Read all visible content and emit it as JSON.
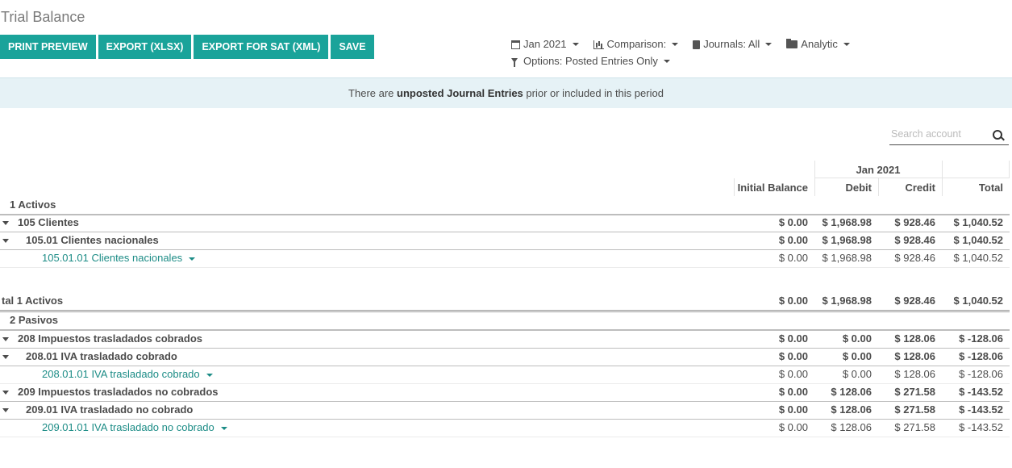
{
  "page": {
    "title": "Trial Balance"
  },
  "buttons": [
    "PRINT PREVIEW",
    "EXPORT (XLSX)",
    "EXPORT FOR SAT (XML)",
    "SAVE"
  ],
  "filters": {
    "date": "Jan 2021",
    "comparison": "Comparison:",
    "journals": "Journals: All",
    "analytic": "Analytic",
    "options": "Options: Posted Entries Only"
  },
  "alert": {
    "pre": "There are ",
    "bold": "unposted Journal Entries",
    "post": " prior or included in this period"
  },
  "search": {
    "placeholder": "Search account"
  },
  "table": {
    "period": "Jan 2021",
    "columns": [
      "Initial Balance",
      "Debit",
      "Credit",
      "Total"
    ],
    "rows": [
      {
        "label": "1 Activos",
        "values": [
          "",
          "",
          "",
          ""
        ],
        "style": "group"
      },
      {
        "label": "105 Clientes",
        "values": [
          "$ 0.00",
          "$ 1,968.98",
          "$ 928.46",
          "$ 1,040.52"
        ],
        "style": "lvl1"
      },
      {
        "label": "105.01 Clientes nacionales",
        "values": [
          "$ 0.00",
          "$ 1,968.98",
          "$ 928.46",
          "$ 1,040.52"
        ],
        "style": "lvl2"
      },
      {
        "label": "105.01.01 Clientes nacionales",
        "values": [
          "$ 0.00",
          "$ 1,968.98",
          "$ 928.46",
          "$ 1,040.52"
        ],
        "style": "account"
      },
      {
        "label": "tal 1 Activos",
        "values": [
          "$ 0.00",
          "$ 1,968.98",
          "$ 928.46",
          "$ 1,040.52"
        ],
        "style": "total"
      },
      {
        "label": "2 Pasivos",
        "values": [
          "",
          "",
          "",
          ""
        ],
        "style": "group"
      },
      {
        "label": "208 Impuestos trasladados cobrados",
        "values": [
          "$ 0.00",
          "$ 0.00",
          "$ 128.06",
          "$ -128.06"
        ],
        "style": "lvl1"
      },
      {
        "label": "208.01 IVA trasladado cobrado",
        "values": [
          "$ 0.00",
          "$ 0.00",
          "$ 128.06",
          "$ -128.06"
        ],
        "style": "lvl2"
      },
      {
        "label": "208.01.01 IVA trasladado cobrado",
        "values": [
          "$ 0.00",
          "$ 0.00",
          "$ 128.06",
          "$ -128.06"
        ],
        "style": "account"
      },
      {
        "label": "209 Impuestos trasladados no cobrados",
        "values": [
          "$ 0.00",
          "$ 128.06",
          "$ 271.58",
          "$ -143.52"
        ],
        "style": "lvl1"
      },
      {
        "label": "209.01 IVA trasladado no cobrado",
        "values": [
          "$ 0.00",
          "$ 128.06",
          "$ 271.58",
          "$ -143.52"
        ],
        "style": "lvl2"
      },
      {
        "label": "209.01.01 IVA trasladado no cobrado",
        "values": [
          "$ 0.00",
          "$ 128.06",
          "$ 271.58",
          "$ -143.52"
        ],
        "style": "account"
      }
    ]
  },
  "colors": {
    "primary": "#1aa39a",
    "link": "#1c8c86",
    "alert_bg": "#e6f2f6"
  }
}
